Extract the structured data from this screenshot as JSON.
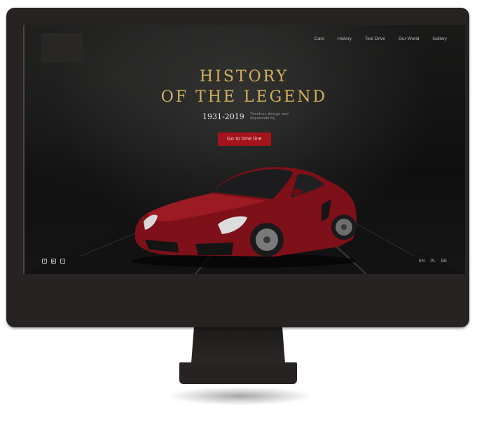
{
  "nav": {
    "items": [
      "Cars",
      "History",
      "Test Drive",
      "Our World",
      "Gallery"
    ]
  },
  "hero": {
    "title_line1": "HISTORY",
    "title_line2": "OF THE LEGEND",
    "years": "1931-2019",
    "tagline": "Timeless design and dependability",
    "cta_label": "Go to time line"
  },
  "social": {
    "icons": [
      "facebook-icon",
      "youtube-icon",
      "instagram-icon"
    ]
  },
  "languages": [
    "EN",
    "PL",
    "DE"
  ],
  "colors": {
    "accent_gold": "#d4b25e",
    "cta_red": "#a3141c",
    "car_red": "#7d1018",
    "bezel": "#262322"
  }
}
